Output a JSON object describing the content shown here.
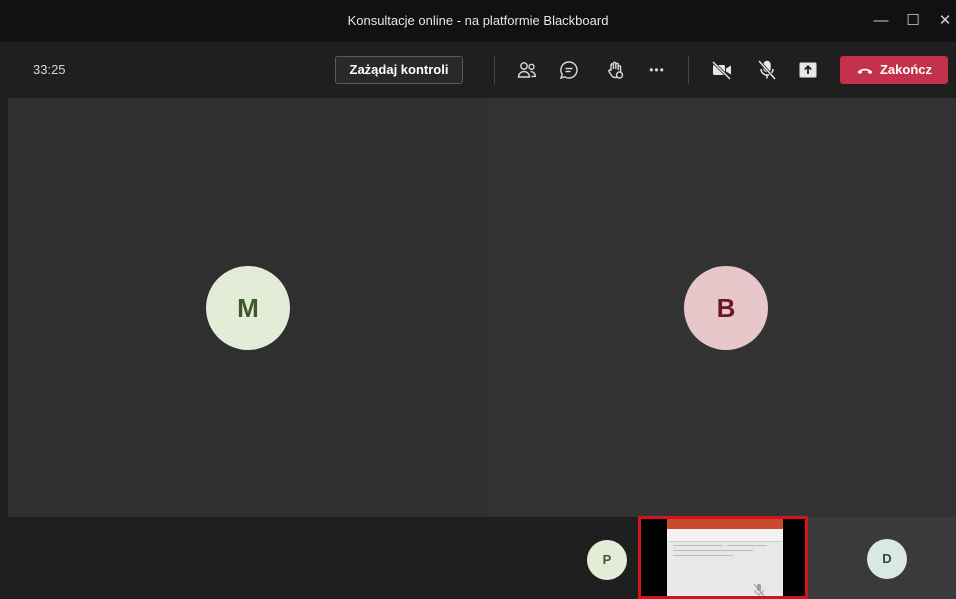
{
  "window": {
    "title": "Konsultacje online - na platformie Blackboard",
    "minimize_glyph": "—",
    "maximize_glyph": "☐",
    "close_glyph": "✕"
  },
  "toolbar": {
    "timer": "33:25",
    "request_control_label": "Zażądaj kontroli",
    "end_label": "Zakończ",
    "more_glyph": "•••",
    "icons": [
      "people-icon",
      "chat-icon",
      "raise-hand-icon",
      "more-icon",
      "camera-off-icon",
      "mic-off-icon",
      "share-screen-icon",
      "phone-hangup-icon"
    ]
  },
  "participants": {
    "main": [
      {
        "initial": "M",
        "bg": "#e3ecd6",
        "fg": "#3f5a2a"
      },
      {
        "initial": "B",
        "bg": "#e8c7cb",
        "fg": "#6b1a24"
      }
    ],
    "strip": [
      {
        "initial": "P",
        "bg": "#e3ecd6",
        "fg": "#3f5a2a"
      },
      {
        "initial": "D",
        "bg": "#d9e8e0",
        "fg": "#2e4a3c"
      }
    ]
  },
  "colors": {
    "end_button": "#c4314b",
    "share_border": "#d0151b"
  }
}
